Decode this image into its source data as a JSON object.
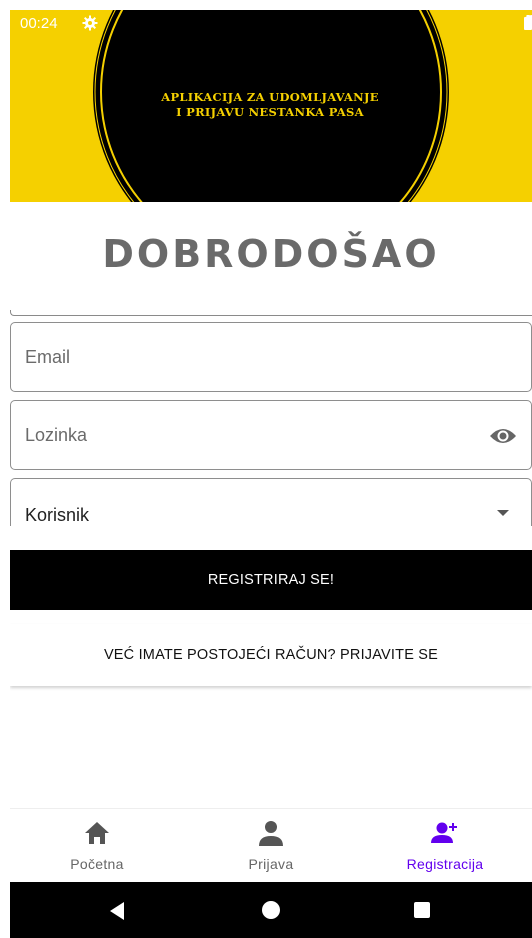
{
  "status_bar": {
    "time": "00:24",
    "icons": [
      "settings-icon",
      "wifi-icon",
      "signal-icon",
      "battery-icon"
    ]
  },
  "banner": {
    "line1": "APLIKACIJA ZA UDOMLJAVANJE",
    "line2": "I PRIJAVU NESTANKA PASA",
    "background": "#f5d000",
    "circle_color": "#000000"
  },
  "welcome_title": "DOBRODOŠAO",
  "form": {
    "email_label": "Email",
    "password_label": "Lozinka",
    "role_value": "Korisnik"
  },
  "buttons": {
    "register": "REGISTRIRAJ SE!",
    "login_link": "VEĆ IMATE POSTOJEĆI RAČUN? PRIJAVITE SE"
  },
  "bottom_nav": {
    "items": [
      {
        "label": "Početna",
        "icon": "home-icon",
        "active": false
      },
      {
        "label": "Prijava",
        "icon": "person-icon",
        "active": false
      },
      {
        "label": "Registracija",
        "icon": "person-add-icon",
        "active": true
      }
    ],
    "active_color": "#6200ee",
    "inactive_color": "#666666"
  }
}
